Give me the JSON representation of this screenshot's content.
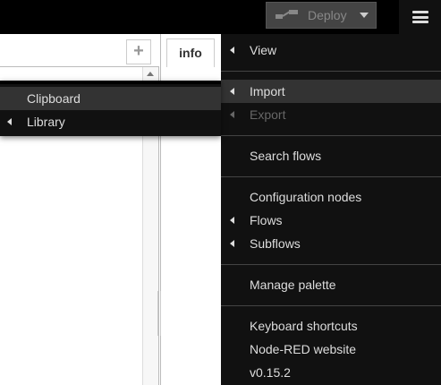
{
  "header": {
    "deploy_label": "Deploy",
    "deploy_icon": "deploy-flow-icon",
    "menu_icon": "hamburger-menu-icon"
  },
  "workspace": {
    "add_tab_label": "+"
  },
  "sidebar": {
    "active_tab": "info"
  },
  "main_menu": {
    "items": [
      {
        "label": "View",
        "submenu": true,
        "state": "normal"
      },
      {
        "label": "Import",
        "submenu": true,
        "state": "active"
      },
      {
        "label": "Export",
        "submenu": true,
        "state": "disabled"
      },
      {
        "label": "Search flows",
        "submenu": false,
        "state": "normal"
      },
      {
        "label": "Configuration nodes",
        "submenu": false,
        "state": "normal"
      },
      {
        "label": "Flows",
        "submenu": true,
        "state": "normal"
      },
      {
        "label": "Subflows",
        "submenu": true,
        "state": "normal"
      },
      {
        "label": "Manage palette",
        "submenu": false,
        "state": "normal"
      },
      {
        "label": "Keyboard shortcuts",
        "submenu": false,
        "state": "normal"
      },
      {
        "label": "Node-RED website",
        "submenu": false,
        "state": "normal"
      },
      {
        "label": "v0.15.2",
        "submenu": false,
        "state": "normal"
      }
    ]
  },
  "import_submenu": {
    "items": [
      {
        "label": "Clipboard",
        "submenu": false,
        "state": "active"
      },
      {
        "label": "Library",
        "submenu": true,
        "state": "normal"
      }
    ]
  }
}
